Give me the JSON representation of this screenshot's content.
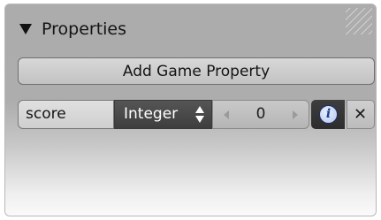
{
  "panel": {
    "title": "Properties",
    "collapse_icon": "triangle-down",
    "grip_icon": "drag-grip"
  },
  "add_button": {
    "label": "Add Game Property"
  },
  "properties": [
    {
      "name": "score",
      "type": "Integer",
      "value": "0",
      "info_icon": "info",
      "remove_icon": "close-x"
    }
  ],
  "colors": {
    "panel_bg": "#adadad",
    "type_select_bg": "#4a4a4a",
    "info_bg": "#333333",
    "info_glyph": "#1d3f93"
  }
}
